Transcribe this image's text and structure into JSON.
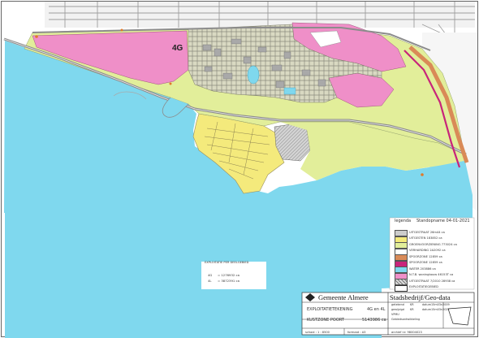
{
  "map": {
    "zone_label": "4G",
    "colors": {
      "water": "#7fd8ee",
      "pink": "#ef8fc8",
      "green": "#e2ee9a",
      "yellow": "#f4ea7c",
      "built": "#a9a9a9",
      "road": "#8c8c8c",
      "ecology": "#d98a57",
      "paper": "#ffffff"
    }
  },
  "legend": {
    "title": "legenda",
    "date_label": "Standopname 04-01-2021",
    "items": [
      {
        "color": "#cccccc",
        "label": "UITGESTRAAT 26m44 ca",
        "pattern": "none"
      },
      {
        "color": "#f4ea7c",
        "label": "UITGESTEN 183852 ca",
        "pattern": "none"
      },
      {
        "color": "#e2ee9a",
        "label": "GROENVOORZIENING 773024 ca",
        "pattern": "none"
      },
      {
        "color": "#ffffff",
        "label": "VERHARDING 2A2092 ca",
        "pattern": "none"
      },
      {
        "color": "#d98a57",
        "label": "SPOORZONE 12859 ca",
        "pattern": "none"
      },
      {
        "color": "#c8247a",
        "label": "SPOORZONE 12859 ca",
        "pattern": "none"
      },
      {
        "color": "#7fd8ee",
        "label": "WATER 203886 ca",
        "pattern": "none"
      },
      {
        "color": "#ef8fc8",
        "label": "N.T.B. woningbouw 46153T ca",
        "pattern": "none"
      },
      {
        "color": "#bdbdbd",
        "label": "UITGESTRAAT 7/2010 28938 ca",
        "pattern": "hatch"
      },
      {
        "color": "#ffffff",
        "label": "EXPLOITATIEGEBIED",
        "pattern": "frame"
      }
    ]
  },
  "exploitatie": {
    "heading": "EXPLOITATIE PER DEELGEBIED",
    "rows": [
      {
        "label": "4G",
        "value": "= 1276932 ca"
      },
      {
        "label": "4L",
        "value": "= 3872391 ca"
      }
    ]
  },
  "title_block": {
    "org_name": "Gemeente Almere",
    "dept_name": "Stadsbedrijf/Geo-data",
    "drawing_title": "EXPLOITATIETEKENING",
    "drawing_subtitle": "4G en 4L",
    "area_name": "KUSTZONE POORT",
    "area_value": "5143986 ca",
    "meta": [
      {
        "k": "getekend",
        "v": "KR",
        "k2": "datum",
        "v2": "15m03n2009"
      },
      {
        "k": "gewijzigd",
        "v": "KR",
        "k2": "datum",
        "v2": "15m03n2021"
      },
      {
        "k": "VPMU",
        "v": "",
        "k2": "",
        "v2": ""
      },
      {
        "k": "Gebiedsontwikkeling",
        "v": "",
        "k2": "",
        "v2": ""
      }
    ],
    "scale": "schaal : 1 : 8500",
    "format": "formaat : A3",
    "archive": "archief nr: 98004023"
  }
}
